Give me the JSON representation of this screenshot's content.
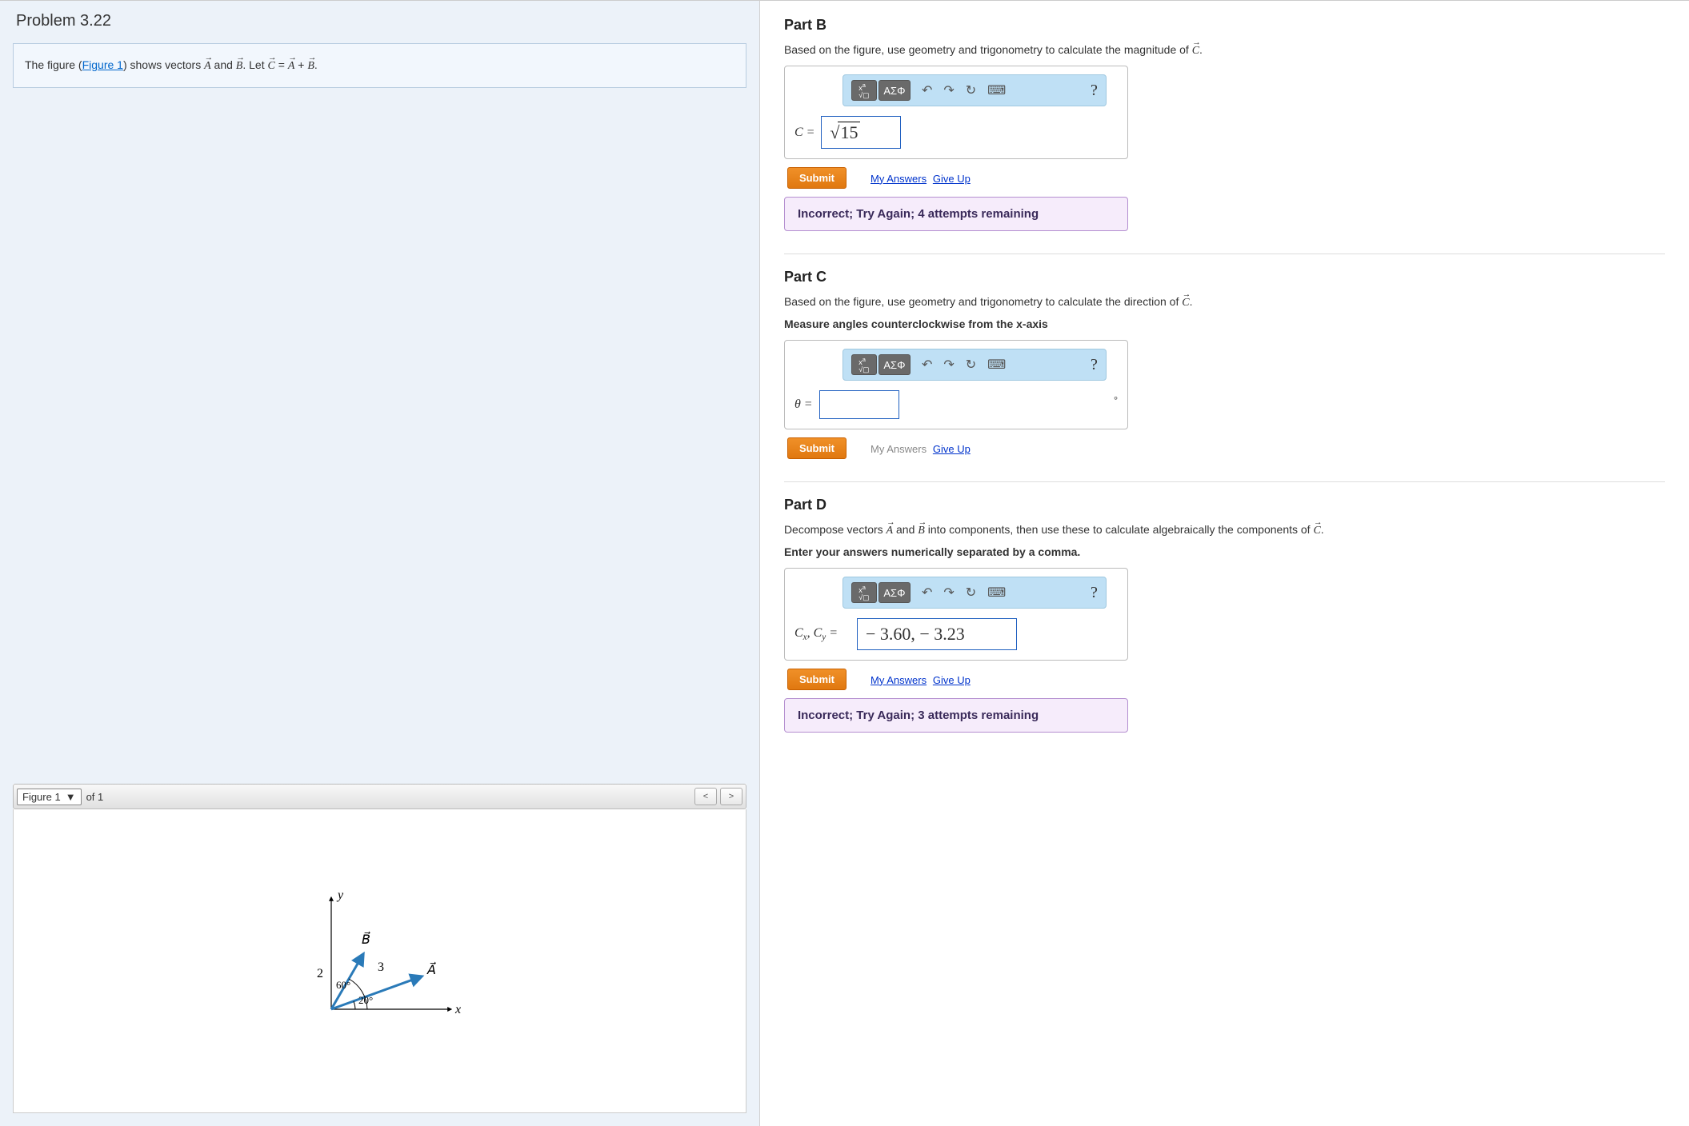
{
  "problem": {
    "title": "Problem 3.22",
    "figure_link_text": "Figure 1",
    "instr_prefix": "The figure (",
    "instr_mid": ") shows vectors ",
    "instr_and": " and ",
    "instr_let": ". Let ",
    "instr_eq": " = ",
    "instr_plus": " + ",
    "instr_dot": "."
  },
  "figure": {
    "selector_label": "Figure 1",
    "of_text": "of 1",
    "y_label": "y",
    "x_label": "x",
    "vec_a_label": "A",
    "vec_b_label": "B",
    "len_b": "2",
    "len_a": "3",
    "ang_b": "60°",
    "ang_a": "20°"
  },
  "toolbar": {
    "templates_label": "▢√▢",
    "greek_label": "ΑΣΦ",
    "help_label": "?"
  },
  "partB": {
    "title": "Part B",
    "instr_prefix": "Based on the figure, use geometry and trigonometry to calculate the magnitude of ",
    "instr_suffix": ".",
    "var_label": "C =",
    "answer_value": "15",
    "submit": "Submit",
    "my_answers": "My Answers",
    "give_up": "Give Up",
    "feedback": "Incorrect; Try Again; 4 attempts remaining"
  },
  "partC": {
    "title": "Part C",
    "instr_prefix": "Based on the figure, use geometry and trigonometry to calculate the direction of ",
    "instr_suffix": ".",
    "sub_instr": "Measure angles counterclockwise from the x-axis",
    "var_label": "θ =",
    "answer_value": "",
    "unit": "°",
    "submit": "Submit",
    "my_answers": "My Answers",
    "give_up": "Give Up"
  },
  "partD": {
    "title": "Part D",
    "instr_prefix": "Decompose vectors ",
    "instr_mid": " and ",
    "instr_mid2": " into components, then use these to calculate algebraically the components of ",
    "instr_suffix": ".",
    "sub_instr": "Enter your answers numerically separated by a comma.",
    "var_label_html": "Cx, Cy =",
    "answer_value": "− 3.60, − 3.23",
    "submit": "Submit",
    "my_answers": "My Answers",
    "give_up": "Give Up",
    "feedback": "Incorrect; Try Again; 3 attempts remaining"
  }
}
